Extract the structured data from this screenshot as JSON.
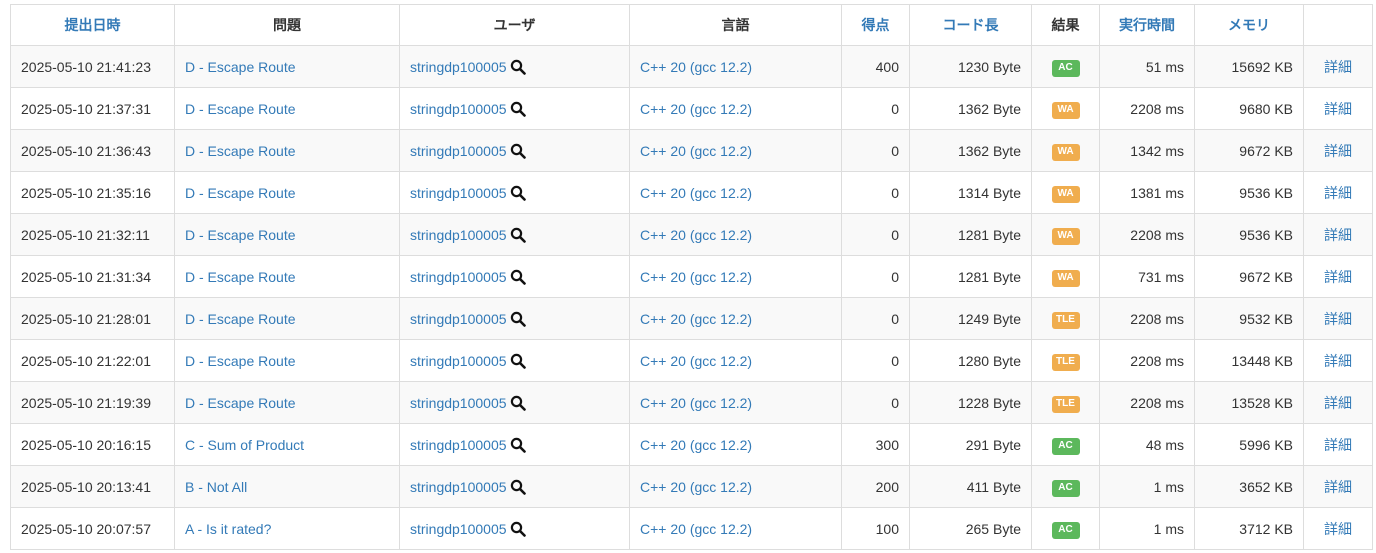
{
  "header": {
    "submitted": "提出日時",
    "task": "問題",
    "user": "ユーザ",
    "language": "言語",
    "score": "得点",
    "code_length": "コード長",
    "result": "結果",
    "exec_time": "実行時間",
    "memory": "メモリ",
    "detail": ""
  },
  "detail_label": "詳細",
  "status_colors": {
    "AC": "#5cb85c",
    "WA": "#f0ad4e",
    "TLE": "#f0ad4e"
  },
  "rows": [
    {
      "time": "2025-05-10 21:41:23",
      "task": "D - Escape Route",
      "user": "stringdp100005",
      "lang": "C++ 20 (gcc 12.2)",
      "score": "400",
      "length": "1230 Byte",
      "status": "AC",
      "exec": "51 ms",
      "memory": "15692 KB"
    },
    {
      "time": "2025-05-10 21:37:31",
      "task": "D - Escape Route",
      "user": "stringdp100005",
      "lang": "C++ 20 (gcc 12.2)",
      "score": "0",
      "length": "1362 Byte",
      "status": "WA",
      "exec": "2208 ms",
      "memory": "9680 KB"
    },
    {
      "time": "2025-05-10 21:36:43",
      "task": "D - Escape Route",
      "user": "stringdp100005",
      "lang": "C++ 20 (gcc 12.2)",
      "score": "0",
      "length": "1362 Byte",
      "status": "WA",
      "exec": "1342 ms",
      "memory": "9672 KB"
    },
    {
      "time": "2025-05-10 21:35:16",
      "task": "D - Escape Route",
      "user": "stringdp100005",
      "lang": "C++ 20 (gcc 12.2)",
      "score": "0",
      "length": "1314 Byte",
      "status": "WA",
      "exec": "1381 ms",
      "memory": "9536 KB"
    },
    {
      "time": "2025-05-10 21:32:11",
      "task": "D - Escape Route",
      "user": "stringdp100005",
      "lang": "C++ 20 (gcc 12.2)",
      "score": "0",
      "length": "1281 Byte",
      "status": "WA",
      "exec": "2208 ms",
      "memory": "9536 KB"
    },
    {
      "time": "2025-05-10 21:31:34",
      "task": "D - Escape Route",
      "user": "stringdp100005",
      "lang": "C++ 20 (gcc 12.2)",
      "score": "0",
      "length": "1281 Byte",
      "status": "WA",
      "exec": "731 ms",
      "memory": "9672 KB"
    },
    {
      "time": "2025-05-10 21:28:01",
      "task": "D - Escape Route",
      "user": "stringdp100005",
      "lang": "C++ 20 (gcc 12.2)",
      "score": "0",
      "length": "1249 Byte",
      "status": "TLE",
      "exec": "2208 ms",
      "memory": "9532 KB"
    },
    {
      "time": "2025-05-10 21:22:01",
      "task": "D - Escape Route",
      "user": "stringdp100005",
      "lang": "C++ 20 (gcc 12.2)",
      "score": "0",
      "length": "1280 Byte",
      "status": "TLE",
      "exec": "2208 ms",
      "memory": "13448 KB"
    },
    {
      "time": "2025-05-10 21:19:39",
      "task": "D - Escape Route",
      "user": "stringdp100005",
      "lang": "C++ 20 (gcc 12.2)",
      "score": "0",
      "length": "1228 Byte",
      "status": "TLE",
      "exec": "2208 ms",
      "memory": "13528 KB"
    },
    {
      "time": "2025-05-10 20:16:15",
      "task": "C - Sum of Product",
      "user": "stringdp100005",
      "lang": "C++ 20 (gcc 12.2)",
      "score": "300",
      "length": "291 Byte",
      "status": "AC",
      "exec": "48 ms",
      "memory": "5996 KB"
    },
    {
      "time": "2025-05-10 20:13:41",
      "task": "B - Not All",
      "user": "stringdp100005",
      "lang": "C++ 20 (gcc 12.2)",
      "score": "200",
      "length": "411 Byte",
      "status": "AC",
      "exec": "1 ms",
      "memory": "3652 KB"
    },
    {
      "time": "2025-05-10 20:07:57",
      "task": "A - Is it rated?",
      "user": "stringdp100005",
      "lang": "C++ 20 (gcc 12.2)",
      "score": "100",
      "length": "265 Byte",
      "status": "AC",
      "exec": "1 ms",
      "memory": "3712 KB"
    }
  ]
}
